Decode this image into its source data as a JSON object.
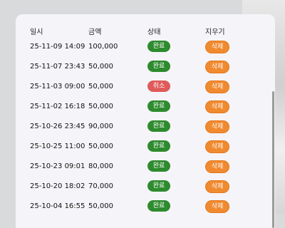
{
  "table": {
    "headers": {
      "date": "일시",
      "amount": "금액",
      "status": "상태",
      "delete": "지우기"
    },
    "rows": [
      {
        "date": "25-11-09 14:09",
        "amount": "100,000",
        "status": "완료",
        "status_type": "done",
        "delete": "삭제"
      },
      {
        "date": "25-11-07 23:43",
        "amount": "50,000",
        "status": "완료",
        "status_type": "done",
        "delete": "삭제"
      },
      {
        "date": "25-11-03 09:00",
        "amount": "50,000",
        "status": "취소",
        "status_type": "cancel",
        "delete": "삭제"
      },
      {
        "date": "25-11-02 16:18",
        "amount": "50,000",
        "status": "완료",
        "status_type": "done",
        "delete": "삭제"
      },
      {
        "date": "25-10-26 23:45",
        "amount": "90,000",
        "status": "완료",
        "status_type": "done",
        "delete": "삭제"
      },
      {
        "date": "25-10-25 11:00",
        "amount": "50,000",
        "status": "완료",
        "status_type": "done",
        "delete": "삭제"
      },
      {
        "date": "25-10-23 09:01",
        "amount": "80,000",
        "status": "완료",
        "status_type": "done",
        "delete": "삭제"
      },
      {
        "date": "25-10-20 18:02",
        "amount": "70,000",
        "status": "완료",
        "status_type": "done",
        "delete": "삭제"
      },
      {
        "date": "25-10-04 16:55",
        "amount": "50,000",
        "status": "완료",
        "status_type": "done",
        "delete": "삭제"
      }
    ]
  },
  "colors": {
    "done": "#2e8b2e",
    "cancel": "#e05a5a",
    "delete": "#f08a30",
    "panel": "#f5f5f9"
  }
}
